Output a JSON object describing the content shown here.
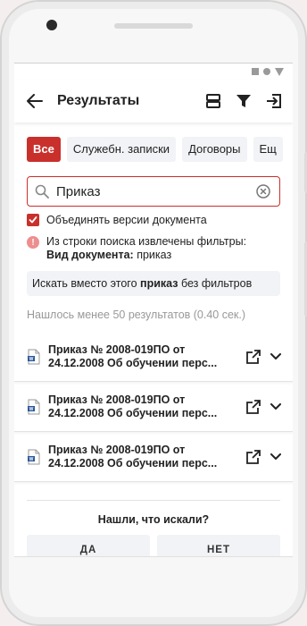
{
  "app": {
    "title": "Результаты"
  },
  "filters": {
    "chips": [
      "Все",
      "Служебн. записки",
      "Договоры",
      "Ещ"
    ],
    "active_color": "#c9302c"
  },
  "search": {
    "value": "Приказ"
  },
  "merge_versions": {
    "label": "Объединять версии документа",
    "checked": true
  },
  "info": {
    "line1": "Из строки поиска извлечены фильтры:",
    "filter_key": "Вид документа:",
    "filter_value": " приказ"
  },
  "alt_search": {
    "prefix": "Искать вместо этого ",
    "term": "приказ",
    "suffix": " без фильтров"
  },
  "results_count": "Нашлось менее 50 результатов (0.40 сек.)",
  "results": [
    {
      "title_line1": "Приказ № 2008-019ПО от",
      "title_line2": "24.12.2008 Об обучении перс..."
    },
    {
      "title_line1": "Приказ № 2008-019ПО от",
      "title_line2": "24.12.2008 Об обучении перс..."
    },
    {
      "title_line1": "Приказ № 2008-019ПО от",
      "title_line2": "24.12.2008 Об обучении перс..."
    }
  ],
  "feedback": {
    "question": "Нашли, что искали?",
    "yes": "ДА",
    "no": "НЕТ"
  }
}
